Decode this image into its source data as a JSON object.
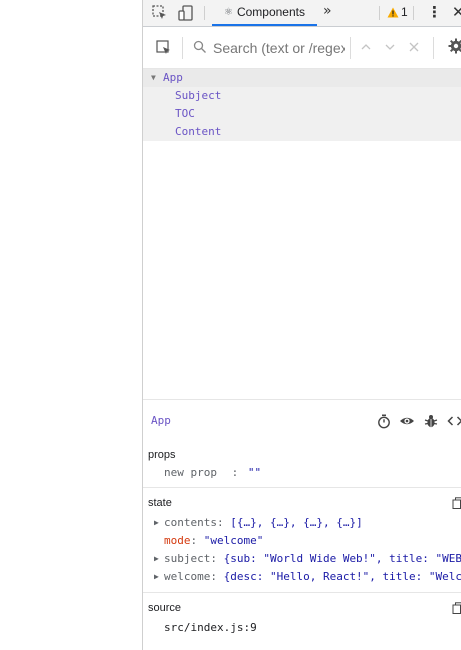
{
  "toolbar": {
    "active_tab": "Components",
    "tab_icon": "react-atom-icon",
    "more_tabs_glyph": "»",
    "warning_count": "1"
  },
  "search": {
    "placeholder": "Search (text or /regex/)"
  },
  "tree": {
    "root": "App",
    "children": [
      "Subject",
      "TOC",
      "Content"
    ]
  },
  "inspected": {
    "name": "App"
  },
  "props": {
    "title": "props",
    "items": [
      {
        "key": "new prop",
        "sep": ":",
        "value": "\"\""
      }
    ]
  },
  "state": {
    "title": "state",
    "items": [
      {
        "key": "contents",
        "value": "[{…}, {…}, {…}, {…}]",
        "expandable": true,
        "changed": false
      },
      {
        "key": "mode",
        "value": "\"welcome\"",
        "expandable": false,
        "changed": true
      },
      {
        "key": "subject",
        "value": "{sub: \"World Wide Web!\", title: \"WEB\"}",
        "expandable": true,
        "changed": false
      },
      {
        "key": "welcome",
        "value": "{desc: \"Hello, React!\", title: \"Welcome\"}",
        "expandable": true,
        "changed": false
      }
    ]
  },
  "source": {
    "title": "source",
    "location": "src/index.js:9"
  },
  "colors": {
    "component_name": "#6a54c5",
    "active_tab_underline": "#1a73e8",
    "warning": "#f9ab00",
    "changed_key": "#d4380d",
    "value": "#1a1aa6"
  }
}
